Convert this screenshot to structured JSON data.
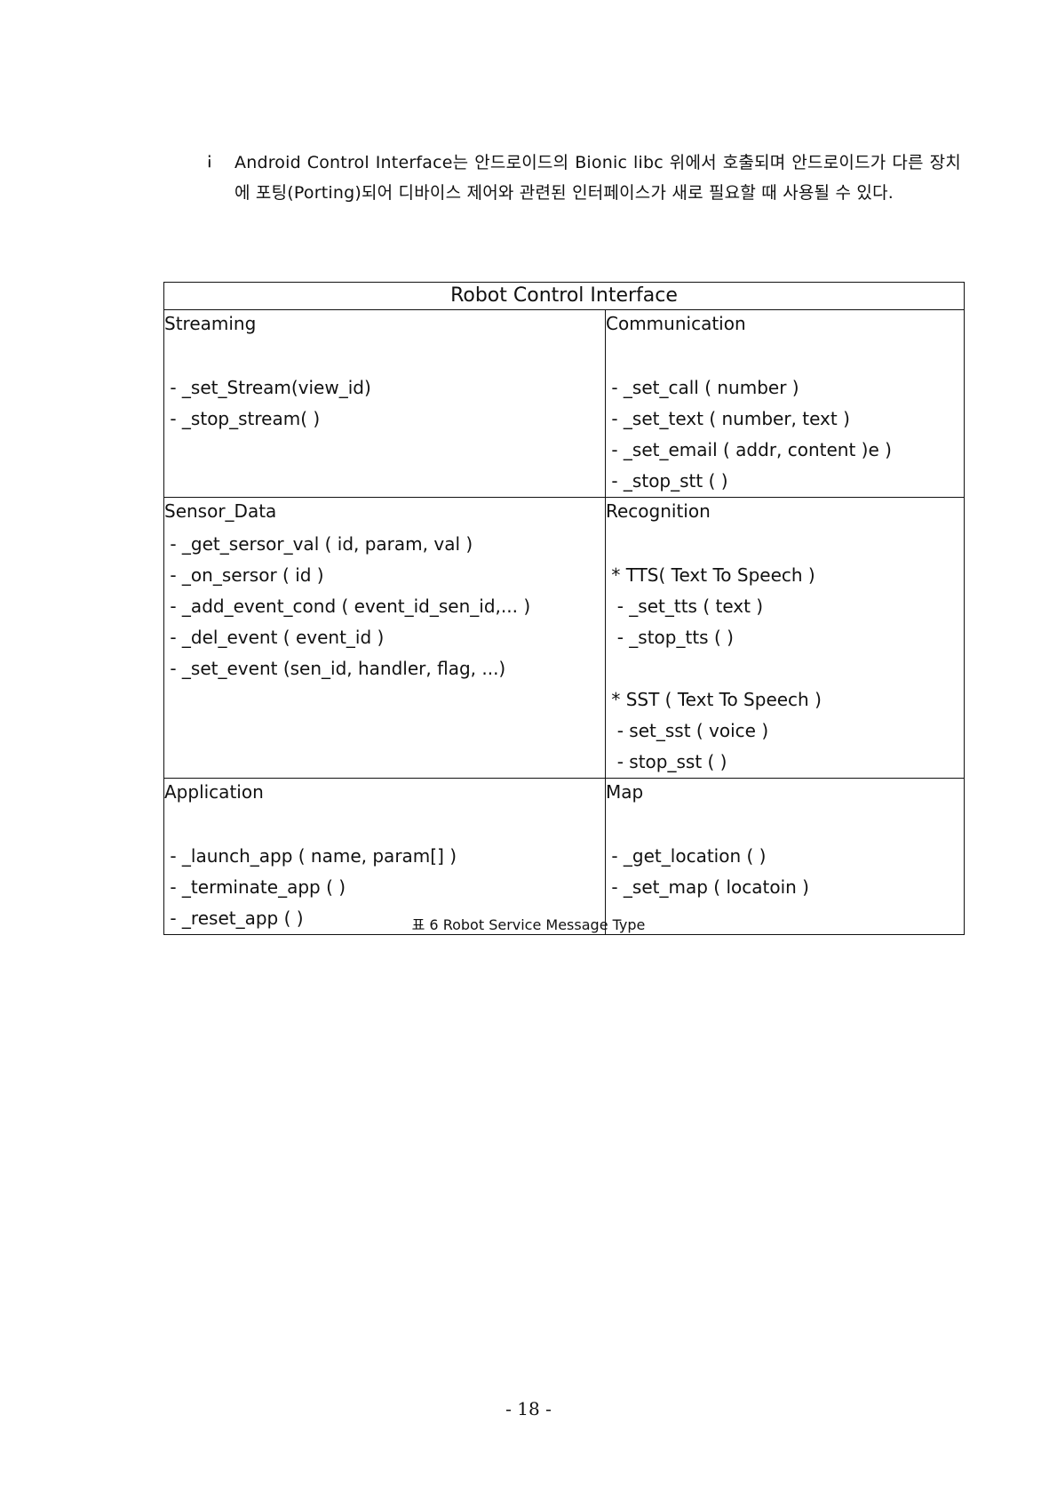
{
  "intro": {
    "bullet": "¡",
    "text": "Android Control Interface는 안드로이드의 Bionic libc 위에서 호출되며 안드로이드가 다른 장치에 포팅(Porting)되어 디바이스 제어와 관련된 인터페이스가 새로 필요할 때 사용될 수 있다."
  },
  "table": {
    "title": "Robot Control Interface",
    "rows": [
      {
        "left": {
          "heading": "Streaming",
          "lines": [
            "",
            " - _set_Stream(view_id)",
            " - _stop_stream( )"
          ]
        },
        "right": {
          "heading": "Communication",
          "lines": [
            "",
            " - _set_call ( number )",
            " - _set_text ( number, text )",
            " - _set_email ( addr, content )e )",
            " - _stop_stt ( )"
          ]
        }
      },
      {
        "left": {
          "heading": "Sensor_Data",
          "lines": [
            " - _get_sersor_val ( id, param, val )",
            " - _on_sersor ( id )",
            " - _add_event_cond ( event_id_sen_id,... )",
            " - _del_event ( event_id )",
            " - _set_event (sen_id, handler, flag, ...)"
          ]
        },
        "right": {
          "heading": "Recognition",
          "lines": [
            "",
            " * TTS( Text To Speech )",
            "  - _set_tts ( text )",
            "  - _stop_tts ( )",
            "",
            " * SST ( Text To Speech )",
            "  - set_sst ( voice )",
            "  - stop_sst ( )"
          ]
        }
      },
      {
        "left": {
          "heading": "Application",
          "lines": [
            "",
            " - _launch_app ( name, param[] )",
            " - _terminate_app ( )",
            " - _reset_app ( )"
          ]
        },
        "right": {
          "heading": "Map",
          "lines": [
            "",
            " - _get_location ( )",
            " - _set_map ( locatoin )"
          ]
        }
      }
    ]
  },
  "caption": "표 6 Robot Service Message Type",
  "page_number": "- 18 -"
}
